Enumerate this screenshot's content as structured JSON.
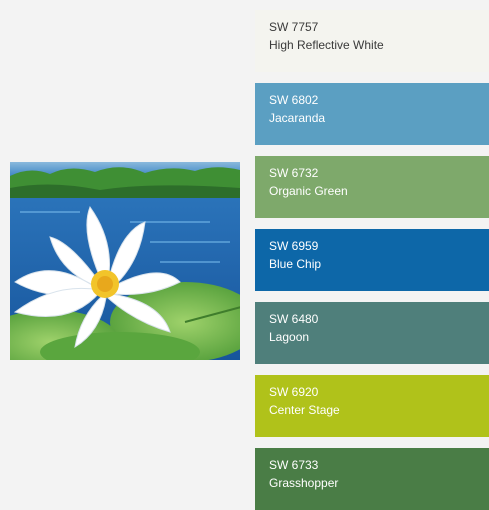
{
  "swatches": [
    {
      "code": "SW 7757",
      "name": "High Reflective White",
      "color": "#f4f4ef",
      "text_color": "#3a3a3a"
    },
    {
      "code": "SW 6802",
      "name": "Jacaranda",
      "color": "#5b9fc2",
      "text_color": "#ffffff"
    },
    {
      "code": "SW 6732",
      "name": "Organic Green",
      "color": "#7ea96b",
      "text_color": "#ffffff"
    },
    {
      "code": "SW 6959",
      "name": "Blue Chip",
      "color": "#0d67a8",
      "text_color": "#ffffff"
    },
    {
      "code": "SW 6480",
      "name": "Lagoon",
      "color": "#4f7f7b",
      "text_color": "#ffffff"
    },
    {
      "code": "SW 6920",
      "name": "Center Stage",
      "color": "#b0c21a",
      "text_color": "#ffffff"
    },
    {
      "code": "SW 6733",
      "name": "Grasshopper",
      "color": "#4a7d46",
      "text_color": "#ffffff"
    }
  ]
}
